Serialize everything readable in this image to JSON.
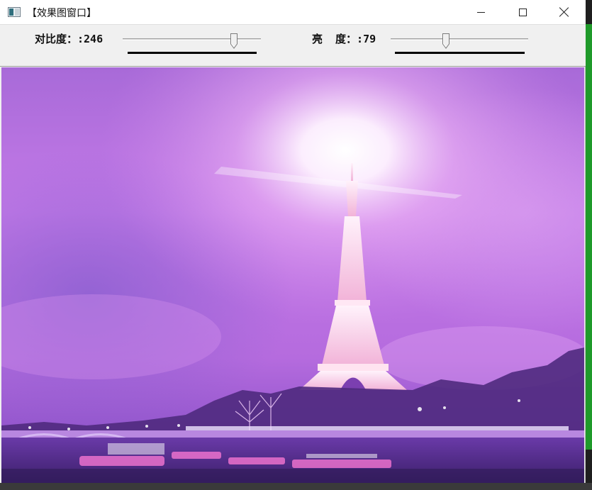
{
  "window": {
    "title": "【效果图窗口】",
    "buttons": {
      "minimize": "minimize",
      "maximize": "maximize",
      "close": "close"
    }
  },
  "controls": {
    "contrast": {
      "label": "对比度：:246",
      "value": 246,
      "max": 300
    },
    "brightness": {
      "label": "亮  度：:79",
      "value": 79,
      "max": 200
    }
  },
  "image": {
    "description_colors": {
      "sky": "#c77be6",
      "glow": "#ffffff",
      "tower": "#f6d7f2",
      "water": "#5a2b88"
    }
  }
}
